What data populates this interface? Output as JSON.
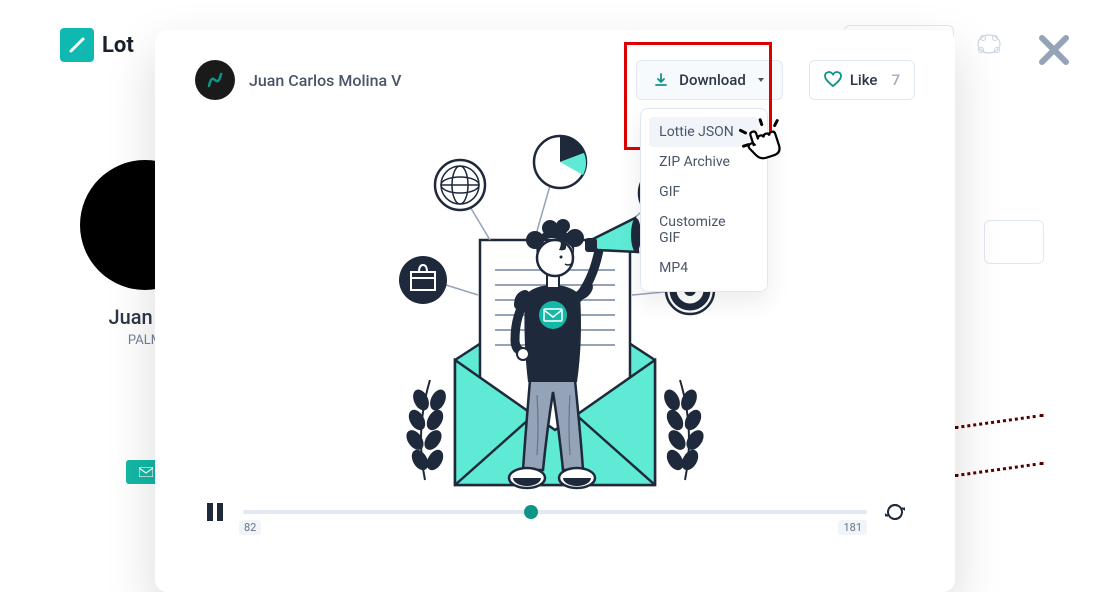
{
  "brand": {
    "name": "Lot"
  },
  "bg": {
    "author_name": "Juan Ca",
    "location": "PALM"
  },
  "modal": {
    "author": "Juan Carlos Molina V",
    "download_label": "Download",
    "like_label": "Like",
    "like_count": "7",
    "dropdown_items": [
      "Lottie JSON",
      "ZIP Archive",
      "GIF",
      "Customize GIF",
      "MP4"
    ],
    "player": {
      "current_frame": "82",
      "total_frames": "181"
    }
  },
  "colors": {
    "accent": "#14b8a6",
    "highlight": "#d00"
  }
}
